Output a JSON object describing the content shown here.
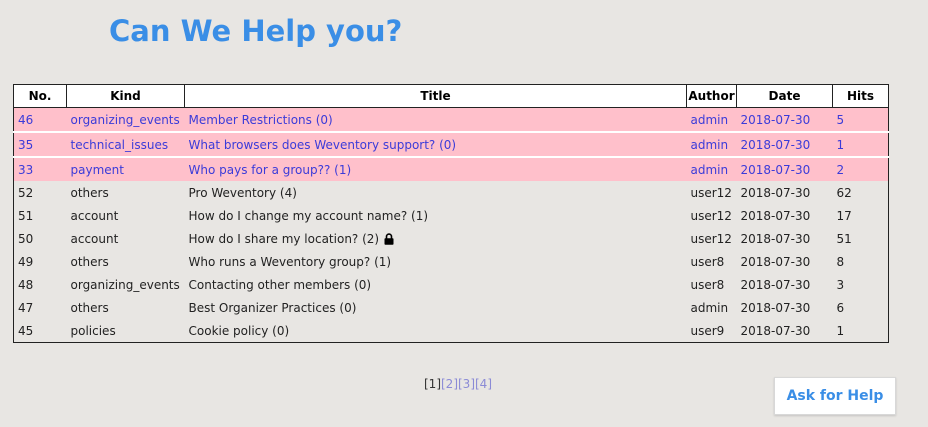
{
  "page_title": "Can We Help you?",
  "table": {
    "headers": [
      "No.",
      "Kind",
      "Title",
      "Author",
      "Date",
      "Hits"
    ],
    "rows": [
      {
        "no": "46",
        "kind": "organizing_events",
        "title": "Member Restrictions (0)",
        "author": "admin",
        "date": "2018-07-30",
        "hits": "5",
        "pinned": true,
        "locked": false
      },
      {
        "no": "35",
        "kind": "technical_issues",
        "title": "What browsers does Weventory support? (0)",
        "author": "admin",
        "date": "2018-07-30",
        "hits": "1",
        "pinned": true,
        "locked": false
      },
      {
        "no": "33",
        "kind": "payment",
        "title": "Who pays for a group?? (1)",
        "author": "admin",
        "date": "2018-07-30",
        "hits": "2",
        "pinned": true,
        "locked": false
      },
      {
        "no": "52",
        "kind": "others",
        "title": "Pro Weventory (4)",
        "author": "user12",
        "date": "2018-07-30",
        "hits": "62",
        "pinned": false,
        "locked": false
      },
      {
        "no": "51",
        "kind": "account",
        "title": "How do I change my account name? (1)",
        "author": "user12",
        "date": "2018-07-30",
        "hits": "17",
        "pinned": false,
        "locked": false
      },
      {
        "no": "50",
        "kind": "account",
        "title": "How do I share my location? (2)",
        "author": "user12",
        "date": "2018-07-30",
        "hits": "51",
        "pinned": false,
        "locked": true
      },
      {
        "no": "49",
        "kind": "others",
        "title": "Who runs a Weventory group? (1)",
        "author": "user8",
        "date": "2018-07-30",
        "hits": "8",
        "pinned": false,
        "locked": false
      },
      {
        "no": "48",
        "kind": "organizing_events",
        "title": "Contacting other members (0)",
        "author": "user8",
        "date": "2018-07-30",
        "hits": "3",
        "pinned": false,
        "locked": false
      },
      {
        "no": "47",
        "kind": "others",
        "title": "Best Organizer Practices (0)",
        "author": "admin",
        "date": "2018-07-30",
        "hits": "6",
        "pinned": false,
        "locked": false
      },
      {
        "no": "45",
        "kind": "policies",
        "title": "Cookie policy (0)",
        "author": "user9",
        "date": "2018-07-30",
        "hits": "1",
        "pinned": false,
        "locked": false
      }
    ]
  },
  "pagination": {
    "current": "[1]",
    "pages": [
      "[2]",
      "[3]",
      "[4]"
    ]
  },
  "help_button": "Ask for Help",
  "icons": {
    "lock": "lock-icon"
  },
  "colors": {
    "accent": "#3a8ee6",
    "pinned_bg": "#ffc0cb",
    "pinned_text": "#3b3bd9"
  }
}
